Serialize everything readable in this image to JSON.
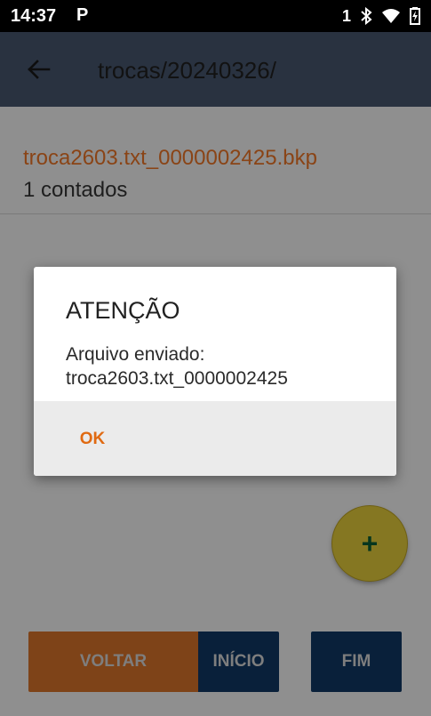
{
  "status_bar": {
    "time": "14:37",
    "notification_letter": "P",
    "sim": "1",
    "icons": [
      "bluetooth-icon",
      "wifi-icon",
      "battery-charging-icon"
    ]
  },
  "app_bar": {
    "back_icon": "arrow-left-icon",
    "title": "trocas/20240326/"
  },
  "file_list": [
    {
      "name": "troca2603.txt_0000002425.bkp",
      "count": "1 contados"
    }
  ],
  "fab": {
    "label": "+"
  },
  "bottom_buttons": {
    "voltar": "VOLTAR",
    "inicio": "INÍCIO",
    "fim": "FIM"
  },
  "dialog": {
    "title": "ATENÇÃO",
    "message_line1": "Arquivo enviado:",
    "message_line2": "troca2603.txt_0000002425",
    "ok_label": "OK"
  },
  "colors": {
    "app_bar": "#293240",
    "file_name": "#8a4416",
    "accent": "#e06a12",
    "navy": "#09203a",
    "fab": "#857722"
  }
}
